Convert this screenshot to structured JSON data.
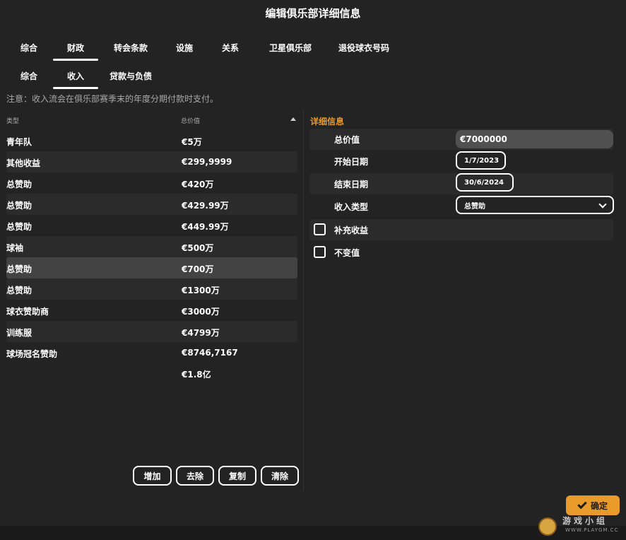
{
  "window": {
    "title": "编辑俱乐部详细信息"
  },
  "main_tabs": [
    "综合",
    "财政",
    "转会条款",
    "设施",
    "关系",
    "卫星俱乐部",
    "退役球衣号码"
  ],
  "sub_tabs": [
    "综合",
    "收入",
    "贷款与负债"
  ],
  "note": "注意：收入流会在俱乐部赛季末的年度分期付款时支付。",
  "list": {
    "headers": {
      "type": "类型",
      "total": "总价值"
    },
    "rows": [
      {
        "type": "青年队",
        "total": "€5万"
      },
      {
        "type": "其他收益",
        "total": "€299,9999"
      },
      {
        "type": "总赞助",
        "total": "€420万"
      },
      {
        "type": "总赞助",
        "total": "€429.99万"
      },
      {
        "type": "总赞助",
        "total": "€449.99万"
      },
      {
        "type": "球袖",
        "total": "€500万"
      },
      {
        "type": "总赞助",
        "total": "€700万"
      },
      {
        "type": "总赞助",
        "total": "€1300万"
      },
      {
        "type": "球衣赞助商",
        "total": "€3000万"
      },
      {
        "type": "训练服",
        "total": "€4799万"
      },
      {
        "type": "球场冠名赞助",
        "total": "€8746,7167"
      }
    ],
    "sum": "€1.8亿"
  },
  "actions": {
    "add": "增加",
    "remove": "去除",
    "copy": "复制",
    "clear": "清除"
  },
  "details": {
    "title": "详细信息",
    "total_value_label": "总价值",
    "total_value": "€7000000",
    "start_date_label": "开始日期",
    "start_date": "1/7/2023",
    "end_date_label": "结束日期",
    "end_date": "30/6/2024",
    "income_type_label": "收入类型",
    "income_type": "总赞助",
    "supplement_label": "补充收益",
    "fixed_label": "不变值"
  },
  "confirm_label": "确定",
  "watermark": {
    "text": "游戏小组",
    "sub": "WWW.PLAYGM.CC"
  },
  "colors": {
    "accent": "#e89a2b",
    "background": "#232323"
  }
}
